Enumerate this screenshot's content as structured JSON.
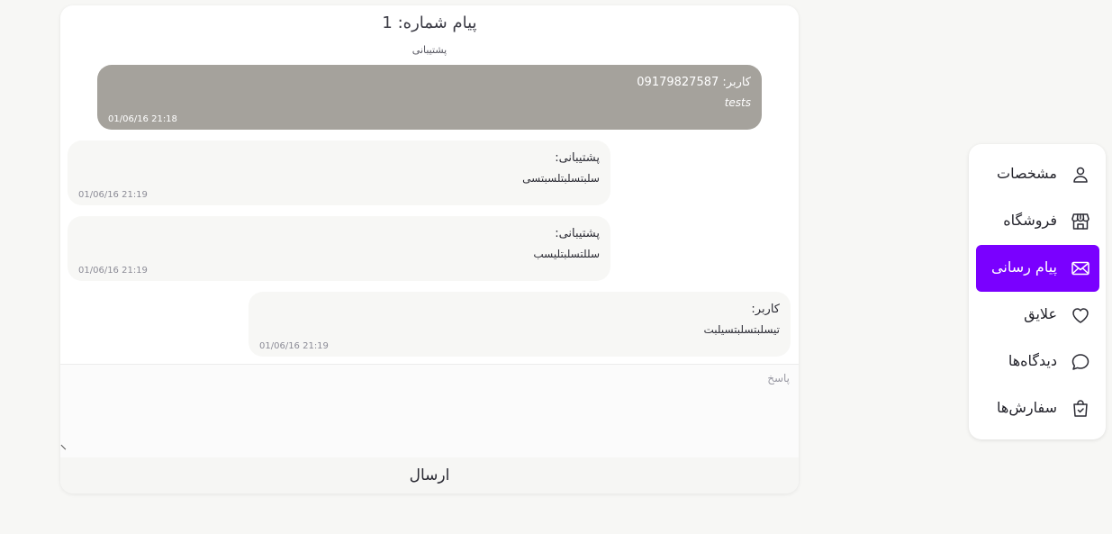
{
  "chat": {
    "title": "پیام شماره: 1",
    "subtitle": "پشتیبانی",
    "messages": [
      {
        "sender": "کاربر: 09179827587",
        "text": "tests",
        "time": "01/06/16 21:18"
      },
      {
        "sender": "پشتیبانی:",
        "text": "سلبتسلبتلسبتسی",
        "time": "01/06/16 21:19"
      },
      {
        "sender": "پشتیبانی:",
        "text": "سللتسلبتلیسب",
        "time": "01/06/16 21:19"
      },
      {
        "sender": "کاربر:",
        "text": "تیسلبتسلبتسیلبت",
        "time": "01/06/16 21:19"
      }
    ],
    "reply_placeholder": "پاسخ",
    "send_label": "ارسال"
  },
  "menu": {
    "accent_color": "#7a00ff",
    "items": [
      {
        "label": "مشخصات",
        "icon": "user-icon",
        "active": false
      },
      {
        "label": "فروشگاه",
        "icon": "store-icon",
        "active": false
      },
      {
        "label": "پیام رسانی",
        "icon": "envelope-icon",
        "active": true
      },
      {
        "label": "علایق",
        "icon": "heart-icon",
        "active": false
      },
      {
        "label": "دیدگاه‌ها",
        "icon": "chat-bubble-icon",
        "active": false
      },
      {
        "label": "سفارش‌ها",
        "icon": "shopping-bag-icon",
        "active": false
      }
    ]
  }
}
